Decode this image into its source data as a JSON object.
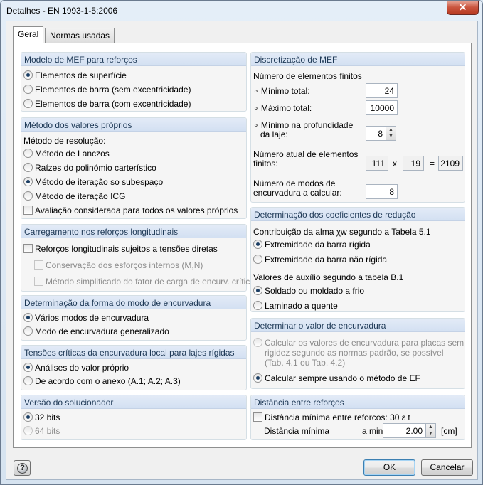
{
  "window": {
    "title": "Detalhes - EN 1993-1-5:2006",
    "close_label": "✕"
  },
  "tabs": [
    {
      "label": "Geral"
    },
    {
      "label": "Normas usadas"
    }
  ],
  "fem_model": {
    "header": "Modelo de MEF para reforços",
    "options": [
      "Elementos de superfície",
      "Elementos de barra (sem excentricidade)",
      "Elementos de barra (com excentricidade)"
    ]
  },
  "eigen": {
    "header": "Método dos valores próprios",
    "solve_label": "Método de resolução:",
    "options": [
      "Método de Lanczos",
      "Raízes do polinómio carterístico",
      "Método de iteração so subespaço",
      "Método de iteração ICG"
    ],
    "all_values_label": "Avaliação considerada para todos os valores próprios"
  },
  "loading": {
    "header": "Carregamento nos reforços longitudinais",
    "direct_stress_label": "Reforços longitudinais sujeitos a tensões diretas",
    "conservation_label": "Conservação dos esforços internos (M,N)",
    "simplified_label": "Método simplificado do fator de carga de encurv. crítico"
  },
  "mode_shape": {
    "header": "Determinação da forma do modo de encurvadura",
    "options": [
      "Vários modos de encurvadura",
      "Modo de encurvadura generalizado"
    ]
  },
  "critical": {
    "header": "Tensões críticas da encurvadura local para lajes rígidas",
    "options": [
      "Análises do valor próprio",
      "De acordo com o anexo (A.1; A.2; A.3)"
    ]
  },
  "solver": {
    "header": "Versão do solucionador",
    "options": [
      "32 bits",
      "64 bits"
    ]
  },
  "discretization": {
    "header": "Discretização de MEF",
    "count_label": "Número de elementos finitos",
    "min_label": "Mínimo total:",
    "min_value": "24",
    "max_label": "Máximo total:",
    "max_value": "10000",
    "depth_label_1": "Mínimo na profundidade",
    "depth_label_2": "da laje:",
    "depth_value": "8",
    "actual_label_1": "Número atual de elementos",
    "actual_label_2": "finitos:",
    "actual_a": "111",
    "times": "x",
    "actual_b": "19",
    "equals": "=",
    "actual_total": "2109",
    "modes_label_1": "Número de modos de",
    "modes_label_2": "encurvadura a calcular:",
    "modes_value": "8"
  },
  "reduction": {
    "header": "Determinação dos coeficientes de redução",
    "web_label": "Contribuição da alma χw segundo a Tabela 5.1",
    "web_options": [
      "Extremidade da barra rígida",
      "Extremidade da barra não rígida"
    ],
    "aux_label": "Valores de auxílio segundo a tabela B.1",
    "aux_options": [
      "Soldado ou moldado a frio",
      "Laminado a quente"
    ]
  },
  "buckling_value": {
    "header": "Determinar o valor de encurvadura",
    "option_std_1": "Calcular os valores de encurvadura para placas sem",
    "option_std_2": "rigidez segundo as normas padrão, se possível",
    "option_std_3": "(Tab. 4.1 ou Tab. 4.2)",
    "option_fe": "Calcular sempre usando o método de EF"
  },
  "stiffener_distance": {
    "header": "Distância entre reforços",
    "min_check_label": "Distância mínima entre reforcos: 30 ε t",
    "min_label": "Distância mínima",
    "symbol": "a min:",
    "value": "2.00",
    "unit": "[cm]"
  },
  "buttons": {
    "ok": "OK",
    "cancel": "Cancelar"
  }
}
